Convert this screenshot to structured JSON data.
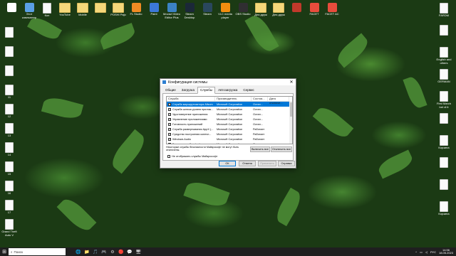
{
  "desktop": {
    "top_icons": [
      {
        "label": "",
        "type": "app",
        "color": "#ffffff"
      },
      {
        "label": "Этот компьютер",
        "type": "app",
        "color": "#5aa0e6"
      },
      {
        "label": "Кол",
        "type": "doc",
        "color": ""
      },
      {
        "label": "YouTube",
        "type": "folder",
        "color": ""
      },
      {
        "label": "Mobile",
        "type": "folder",
        "color": ""
      },
      {
        "label": "",
        "type": "folder",
        "color": ""
      },
      {
        "label": "POSHI Pajo",
        "type": "folder",
        "color": ""
      },
      {
        "label": "FL Studio",
        "type": "app",
        "color": "#f08a24"
      },
      {
        "label": "Paint",
        "type": "app",
        "color": "#3c78d8"
      },
      {
        "label": "Movavi Video Editor Plus",
        "type": "app",
        "color": "#3b82c4"
      },
      {
        "label": "Steam Desktop",
        "type": "app",
        "color": "#1b2838"
      },
      {
        "label": "Steam",
        "type": "app",
        "color": "#2a475e"
      },
      {
        "label": "VLC media player",
        "type": "app",
        "color": "#f28c0f"
      },
      {
        "label": "OBS Studio",
        "type": "app",
        "color": "#302e31"
      },
      {
        "label": "Для друж",
        "type": "folder",
        "color": ""
      },
      {
        "label": "Для друж",
        "type": "folder",
        "color": ""
      },
      {
        "label": "",
        "type": "app",
        "color": "#c0392b"
      },
      {
        "label": "FACET",
        "type": "app",
        "color": "#e74c3c"
      },
      {
        "label": "FACET AC",
        "type": "app",
        "color": "#e74c3c"
      }
    ],
    "left_icons": [
      {
        "label": ""
      },
      {
        "label": ""
      },
      {
        "label": ""
      },
      {
        "label": "11"
      },
      {
        "label": "12"
      },
      {
        "label": "13"
      },
      {
        "label": "14"
      },
      {
        "label": "15"
      },
      {
        "label": "16"
      },
      {
        "label": "17"
      },
      {
        "label": "Grand Theft Auto V"
      }
    ],
    "right_icons": [
      {
        "label": "FARDM"
      },
      {
        "label": ""
      },
      {
        "label": "English and others"
      },
      {
        "label": "GERMAN"
      },
      {
        "label": "First March bet di it"
      },
      {
        "label": ""
      },
      {
        "label": "Корзина"
      },
      {
        "label": ""
      },
      {
        "label": ""
      },
      {
        "label": "Корзина"
      }
    ]
  },
  "dialog": {
    "title": "Конфигурация системы",
    "close_glyph": "✕",
    "tabs": [
      "Общие",
      "Загрузка",
      "Службы",
      "Автозагрузка",
      "Сервис"
    ],
    "active_tab": "Службы",
    "columns": [
      "Служба",
      "Производитель",
      "Состоя...",
      "Дата отключе..."
    ],
    "rows": [
      {
        "name": "Служба маршрутизатора Allsom",
        "vendor": "Microsoft Corporation",
        "status": "Остан...",
        "checked": true,
        "selected": true
      },
      {
        "name": "Служба шлюза уровня прилож...",
        "vendor": "Microsoft Corporation",
        "status": "Остан...",
        "checked": true,
        "selected": false
      },
      {
        "name": "Удостоверение приложения",
        "vendor": "Microsoft Corporation",
        "status": "Остан...",
        "checked": true,
        "selected": false
      },
      {
        "name": "Управление приложениями",
        "vendor": "Microsoft Corporation",
        "status": "Остан...",
        "checked": true,
        "selected": false
      },
      {
        "name": "Готовность приложений",
        "vendor": "Microsoft Corporation",
        "status": "Остан...",
        "checked": true,
        "selected": false
      },
      {
        "name": "Служба развертывания AppX (...",
        "vendor": "Microsoft Corporation",
        "status": "Работает",
        "checked": true,
        "selected": false
      },
      {
        "name": "Средство построения конечн...",
        "vendor": "Microsoft Corporation",
        "status": "Работает",
        "checked": true,
        "selected": false
      },
      {
        "name": "Windows Audio",
        "vendor": "Microsoft Corporation",
        "status": "Работает",
        "checked": true,
        "selected": false
      },
      {
        "name": "Вход в кто-нибудь(всё связи",
        "vendor": "Microsoft Corporation",
        "status": "Остан...",
        "checked": true,
        "selected": false
      },
      {
        "name": "Установщик ActiveX (AxInstSV)",
        "vendor": "Microsoft Corporation",
        "status": "Остан...",
        "checked": true,
        "selected": false
      },
      {
        "name": "Служба шифрования дисков B...",
        "vendor": "Microsoft Corporation",
        "status": "Остан...",
        "checked": true,
        "selected": false
      }
    ],
    "note": "Некоторые службы безопасности Майкрософт не могут быть отключены.",
    "hide_ms_label": "Не отображать службы Майкрософт",
    "enable_all": "Включить все",
    "disable_all": "Отключить все",
    "ok": "ОК",
    "cancel": "Отмена",
    "apply": "Применить",
    "help": "Справка"
  },
  "taskbar": {
    "start_glyph": "⊞",
    "search_placeholder": "Поиск",
    "apps": [
      "🌐",
      "📁",
      "🎵",
      "🎮",
      "⚙",
      "🔴",
      "💬",
      "🖥"
    ],
    "lang": "РУС",
    "time": "14:56",
    "date": "18.05.2023"
  }
}
